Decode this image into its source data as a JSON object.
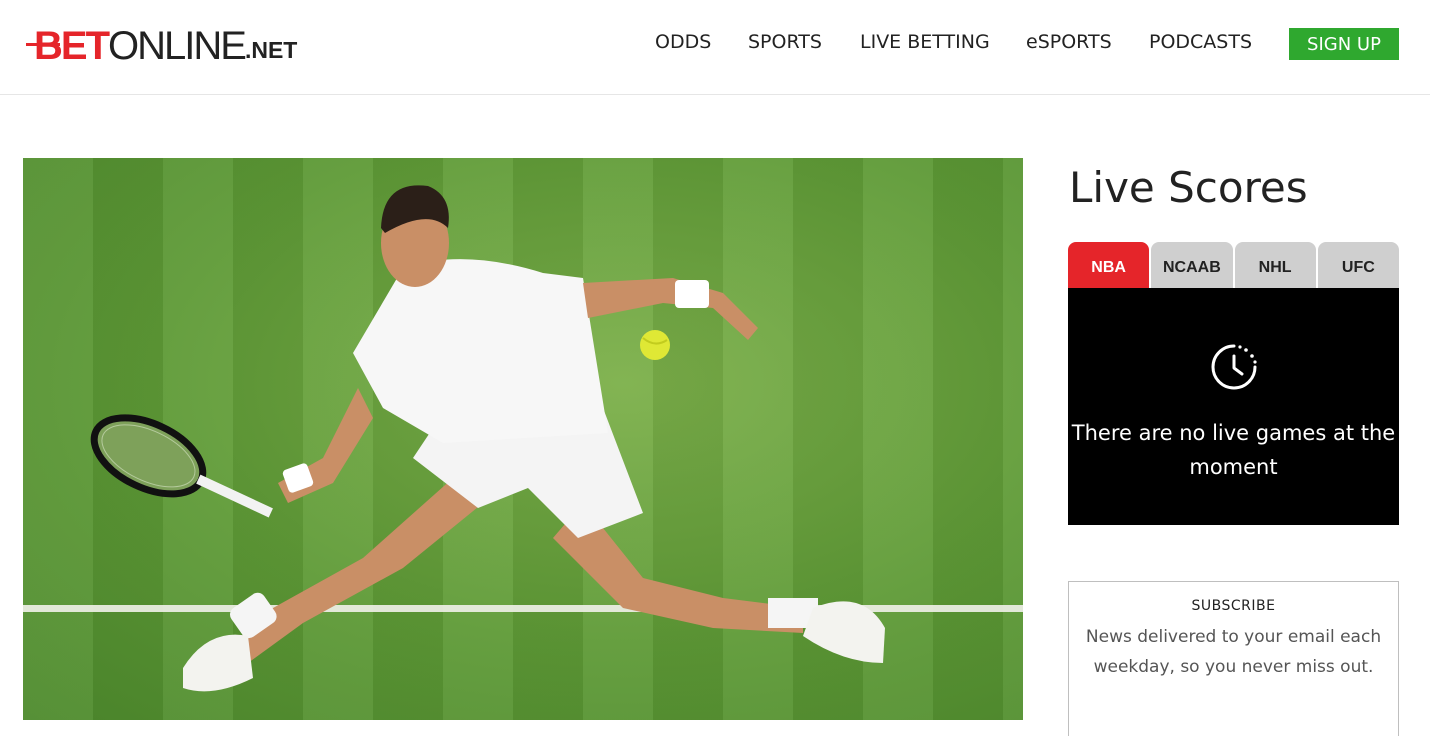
{
  "brand": {
    "bet": "BET",
    "online": "ONLINE",
    "net": ".NET",
    "accent": "#e5252a"
  },
  "nav": {
    "items": [
      "ODDS",
      "SPORTS",
      "LIVE BETTING",
      "eSPORTS",
      "PODCASTS"
    ],
    "signup": "SIGN UP",
    "signup_color": "#2fa82f"
  },
  "hero": {
    "image": "tennis-player-photo"
  },
  "live_scores": {
    "title": "Live Scores",
    "tabs": [
      "NBA",
      "NCAAB",
      "NHL",
      "UFC"
    ],
    "active_tab": "NBA",
    "empty_icon": "clock-icon",
    "empty_message": "There are no live games at the moment"
  },
  "subscribe": {
    "title": "SUBSCRIBE",
    "text": "News delivered to your email each weekday, so you never miss out."
  }
}
